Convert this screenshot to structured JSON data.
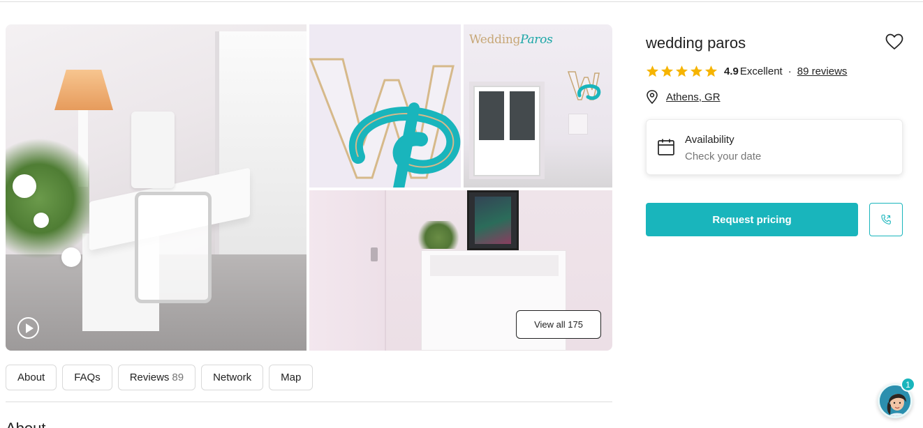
{
  "vendor": {
    "name": "wedding paros",
    "rating": "4.9",
    "rating_label": "Excellent",
    "rating_separator": "·",
    "reviews_link": "89 reviews",
    "stars_filled": 5,
    "location": "Athens, GR"
  },
  "gallery": {
    "photo_logo_sign_text_1": "Wedding",
    "photo_logo_sign_text_2": "Paros",
    "view_all_label": "View all 175"
  },
  "tabs": [
    {
      "label": "About",
      "count": ""
    },
    {
      "label": "FAQs",
      "count": ""
    },
    {
      "label": "Reviews",
      "count": "89"
    },
    {
      "label": "Network",
      "count": ""
    },
    {
      "label": "Map",
      "count": ""
    }
  ],
  "section": {
    "heading": "About"
  },
  "availability": {
    "title": "Availability",
    "subtitle": "Check your date"
  },
  "actions": {
    "request_pricing": "Request pricing"
  },
  "chat": {
    "badge_count": "1"
  },
  "colors": {
    "accent": "#19b5bc",
    "star": "#f6b400",
    "text": "#222222",
    "muted": "#767676"
  },
  "icons": {
    "favorite": "heart-icon",
    "location": "map-pin-icon",
    "calendar": "calendar-icon",
    "phone": "phone-icon",
    "video": "play-icon",
    "star": "star-icon"
  }
}
